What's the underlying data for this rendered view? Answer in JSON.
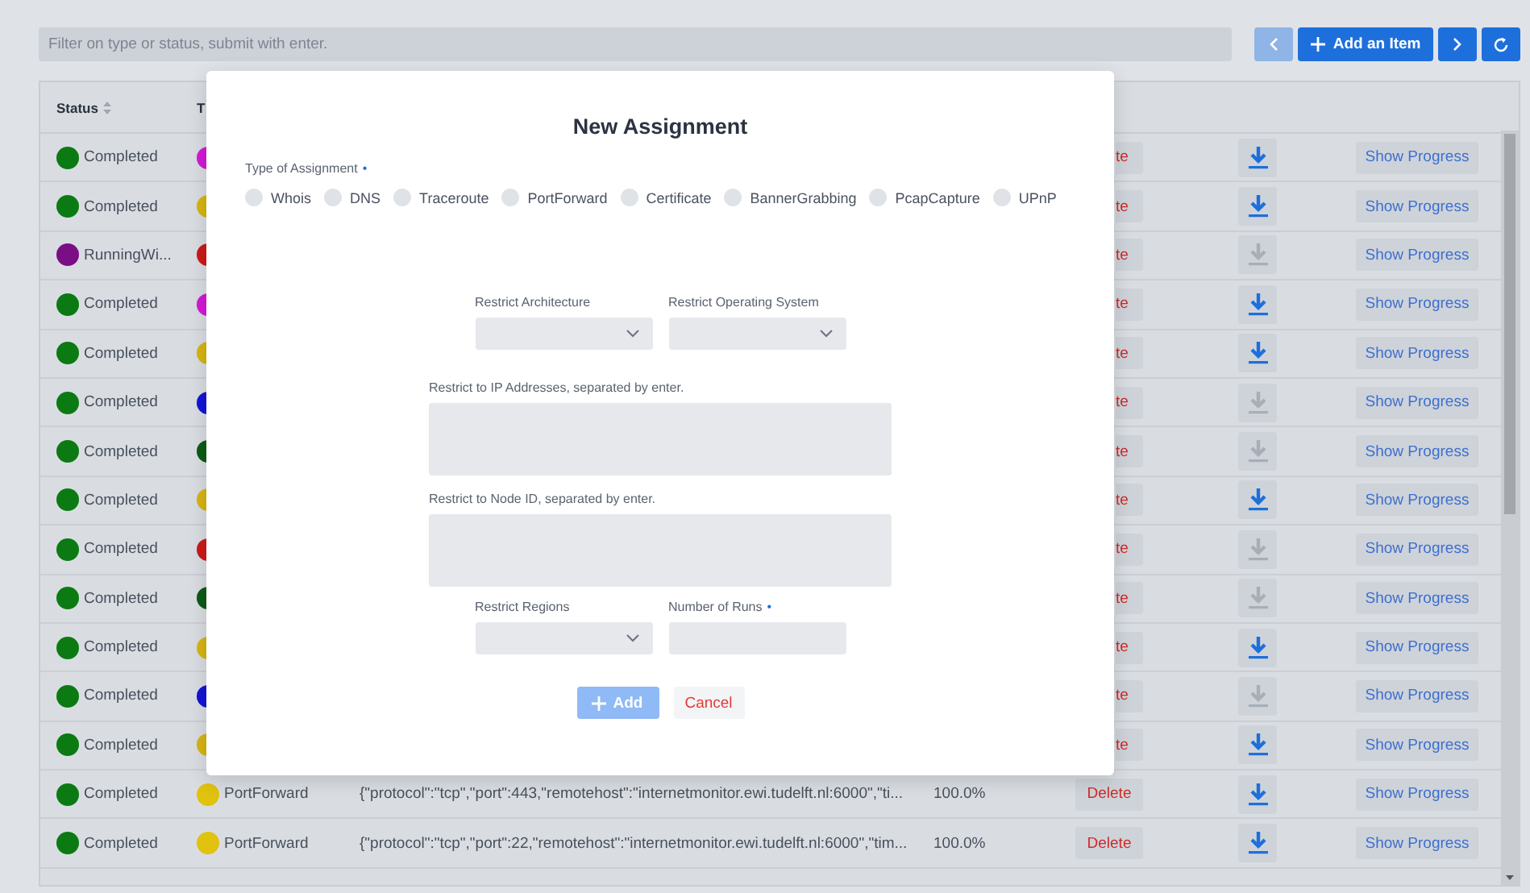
{
  "toolbar": {
    "filter_placeholder": "Filter on type or status, submit with enter.",
    "prev_enabled": false,
    "add_label": "Add an Item",
    "next_enabled": true
  },
  "table": {
    "columns": [
      "Status",
      "T"
    ],
    "rows": [
      {
        "status": {
          "label": "Completed",
          "color": "#0b7a12"
        },
        "type": {
          "color": "#d21ad6"
        },
        "delete": {
          "label": "te",
          "kind": "clipped"
        },
        "download_enabled": true,
        "progress": "Show Progress"
      },
      {
        "status": {
          "label": "Completed",
          "color": "#0b7a12"
        },
        "type": {
          "color": "#d6b512"
        },
        "delete": {
          "label": "te",
          "kind": "clipped"
        },
        "download_enabled": true,
        "progress": "Show Progress"
      },
      {
        "status": {
          "label": "RunningWi...",
          "color": "#7a0f85"
        },
        "type": {
          "color": "#cc1a1a"
        },
        "delete": {
          "label": "te",
          "kind": "clipped"
        },
        "download_enabled": false,
        "progress": "Show Progress"
      },
      {
        "status": {
          "label": "Completed",
          "color": "#0b7a12"
        },
        "type": {
          "color": "#d21ad6"
        },
        "delete": {
          "label": "te",
          "kind": "clipped"
        },
        "download_enabled": true,
        "progress": "Show Progress"
      },
      {
        "status": {
          "label": "Completed",
          "color": "#0b7a12"
        },
        "type": {
          "color": "#d6b512"
        },
        "delete": {
          "label": "te",
          "kind": "clipped"
        },
        "download_enabled": true,
        "progress": "Show Progress"
      },
      {
        "status": {
          "label": "Completed",
          "color": "#0b7a12"
        },
        "type": {
          "color": "#1414d6"
        },
        "delete": {
          "label": "te",
          "kind": "clipped"
        },
        "download_enabled": false,
        "progress": "Show Progress"
      },
      {
        "status": {
          "label": "Completed",
          "color": "#0b7a12"
        },
        "type": {
          "color": "#0e5a16"
        },
        "delete": {
          "label": "te",
          "kind": "clipped"
        },
        "download_enabled": false,
        "progress": "Show Progress"
      },
      {
        "status": {
          "label": "Completed",
          "color": "#0b7a12"
        },
        "type": {
          "color": "#d6b512"
        },
        "delete": {
          "label": "te",
          "kind": "clipped"
        },
        "download_enabled": true,
        "progress": "Show Progress"
      },
      {
        "status": {
          "label": "Completed",
          "color": "#0b7a12"
        },
        "type": {
          "color": "#cc1a1a"
        },
        "delete": {
          "label": "te",
          "kind": "clipped"
        },
        "download_enabled": false,
        "progress": "Show Progress"
      },
      {
        "status": {
          "label": "Completed",
          "color": "#0b7a12"
        },
        "type": {
          "color": "#0e5a16"
        },
        "delete": {
          "label": "te",
          "kind": "clipped"
        },
        "download_enabled": false,
        "progress": "Show Progress"
      },
      {
        "status": {
          "label": "Completed",
          "color": "#0b7a12"
        },
        "type": {
          "color": "#d6b512"
        },
        "delete": {
          "label": "te",
          "kind": "clipped"
        },
        "download_enabled": true,
        "progress": "Show Progress"
      },
      {
        "status": {
          "label": "Completed",
          "color": "#0b7a12"
        },
        "type": {
          "color": "#1414d6"
        },
        "delete": {
          "label": "te",
          "kind": "clipped"
        },
        "download_enabled": false,
        "progress": "Show Progress"
      },
      {
        "status": {
          "label": "Completed",
          "color": "#0b7a12"
        },
        "type": {
          "color": "#d6b512"
        },
        "delete": {
          "label": "te",
          "kind": "clipped"
        },
        "download_enabled": true,
        "progress": "Show Progress"
      },
      {
        "status": {
          "label": "Completed",
          "color": "#0b7a12"
        },
        "type": {
          "label": "PortForward",
          "color": "#e0c20f"
        },
        "params": "{\"protocol\":\"tcp\",\"port\":443,\"remotehost\":\"internetmonitor.ewi.tudelft.nl:6000\",\"ti...",
        "percent": "100.0%",
        "delete": {
          "label": "Delete",
          "kind": "full"
        },
        "download_enabled": true,
        "progress": "Show Progress"
      },
      {
        "status": {
          "label": "Completed",
          "color": "#0b7a12"
        },
        "type": {
          "label": "PortForward",
          "color": "#e0c20f"
        },
        "params": "{\"protocol\":\"tcp\",\"port\":22,\"remotehost\":\"internetmonitor.ewi.tudelft.nl:6000\",\"tim...",
        "percent": "100.0%",
        "delete": {
          "label": "Delete",
          "kind": "full"
        },
        "download_enabled": true,
        "progress": "Show Progress"
      }
    ]
  },
  "modal": {
    "title": "New Assignment",
    "required_mark": "•",
    "type_label": "Type of Assignment",
    "type_required": true,
    "types": [
      {
        "label": "Whois",
        "selected": false
      },
      {
        "label": "DNS",
        "selected": false
      },
      {
        "label": "Traceroute",
        "selected": false
      },
      {
        "label": "PortForward",
        "selected": false
      },
      {
        "label": "Certificate",
        "selected": false
      },
      {
        "label": "BannerGrabbing",
        "selected": false
      },
      {
        "label": "PcapCapture",
        "selected": false
      },
      {
        "label": "UPnP",
        "selected": false
      }
    ],
    "architecture_label": "Restrict Architecture",
    "os_label": "Restrict Operating System",
    "ip_label": "Restrict to IP Addresses, separated by enter.",
    "node_label": "Restrict to Node ID, separated by enter.",
    "regions_label": "Restrict Regions",
    "runs_label": "Number of Runs",
    "runs_required": true,
    "add_label": "Add",
    "add_disabled": true,
    "cancel_label": "Cancel"
  }
}
